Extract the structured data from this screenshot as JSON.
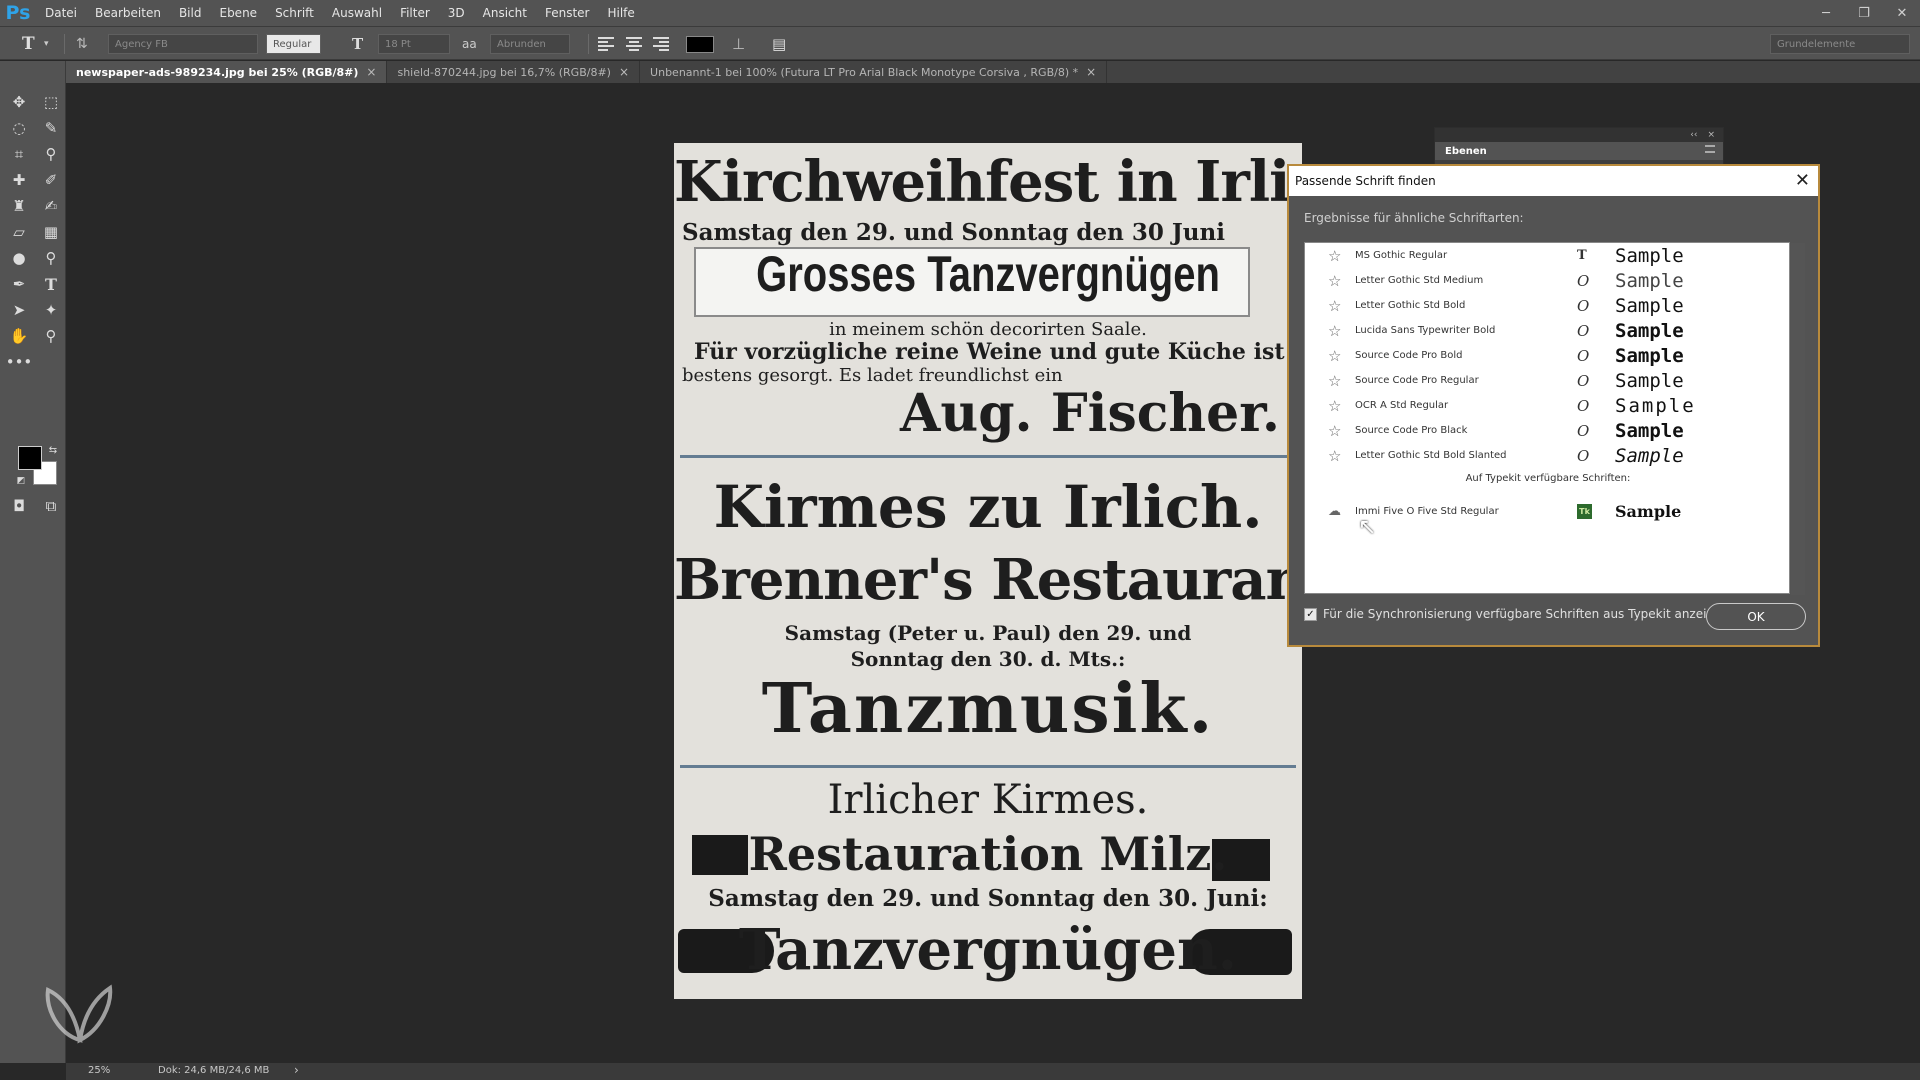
{
  "app": {
    "logo": "Ps"
  },
  "menu": [
    "Datei",
    "Bearbeiten",
    "Bild",
    "Ebene",
    "Schrift",
    "Auswahl",
    "Filter",
    "3D",
    "Ansicht",
    "Fenster",
    "Hilfe"
  ],
  "options": {
    "tool_glyph": "T",
    "font_family": "Agency FB",
    "font_style": "Regular",
    "font_size": "18 Pt",
    "antialias": "Abrunden",
    "workspace": "Grundelemente"
  },
  "tabs": [
    {
      "label": "newspaper-ads-989234.jpg bei 25% (RGB/8#)",
      "close": "×",
      "active": true
    },
    {
      "label": "shield-870244.jpg bei 16,7% (RGB/8#)",
      "close": "×",
      "active": false
    },
    {
      "label": "Unbenannt-1 bei 100% (Futura LT Pro  Arial Black  Monotype Corsiva  , RGB/8) *",
      "close": "×",
      "active": false
    }
  ],
  "document": {
    "l1": "Kirchweihfest in Irlich.",
    "l2": "Samstag den 29. und Sonntag den 30 Juni",
    "l3": "Grosses Tanzvergnügen",
    "l4": "in meinem schön decorirten Saale.",
    "l5": "Für vorzügliche reine Weine und gute Küche ist",
    "l6": "bestens gesorgt. Es ladet freundlichst ein",
    "l7": "Aug. Fischer.",
    "l8": "Kirmes zu Irlich.",
    "l9": "Brenner's Restaurant",
    "l10": "Samstag (Peter u. Paul) den 29. und",
    "l11": "Sonntag den 30. d. Mts.:",
    "l12": "Tanzmusik.",
    "l13": "Irlicher Kirmes.",
    "l14": "Restauration Milz.",
    "l15": "Samstag den 29. und Sonntag den 30. Juni:",
    "l16": "Tanzvergnügen."
  },
  "layers_panel": {
    "tab": "Ebenen",
    "collapse": "‹‹",
    "close": "×"
  },
  "dialog": {
    "title": "Passende Schrift finden",
    "close": "✕",
    "subtitle": "Ergebnisse für ähnliche Schriftarten:",
    "results": [
      {
        "name": "MS Gothic Regular",
        "type": "T",
        "sample": "Sample"
      },
      {
        "name": "Letter Gothic Std Medium",
        "type": "O",
        "sample": "Sample"
      },
      {
        "name": "Letter Gothic Std Bold",
        "type": "O",
        "sample": "Sample"
      },
      {
        "name": "Lucida Sans Typewriter Bold",
        "type": "O",
        "sample": "Sample"
      },
      {
        "name": "Source Code Pro Bold",
        "type": "O",
        "sample": "Sample"
      },
      {
        "name": "Source Code Pro Regular",
        "type": "O",
        "sample": "Sample"
      },
      {
        "name": "OCR A Std Regular",
        "type": "O",
        "sample": "Sample"
      },
      {
        "name": "Source Code Pro Black",
        "type": "O",
        "sample": "Sample"
      },
      {
        "name": "Letter Gothic Std Bold Slanted",
        "type": "O",
        "sample": "Sample"
      }
    ],
    "typekit_heading": "Auf Typekit verfügbare Schriften:",
    "typekit_result": {
      "name": "Immi Five O Five Std Regular",
      "badge": "Tk",
      "sample": "Sample"
    },
    "sync_checked": true,
    "sync_label": "Für die Synchronisierung verfügbare Schriften aus Typekit anzeigen",
    "ok": "OK"
  },
  "status": {
    "zoom": "25%",
    "doc": "Dok: 24,6 MB/24,6 MB",
    "arrow": "›"
  },
  "colors": {
    "accent": "#2fa3e8",
    "dialog_border": "#b88a3c",
    "chrome": "#535353",
    "canvas_bg": "#282828"
  }
}
